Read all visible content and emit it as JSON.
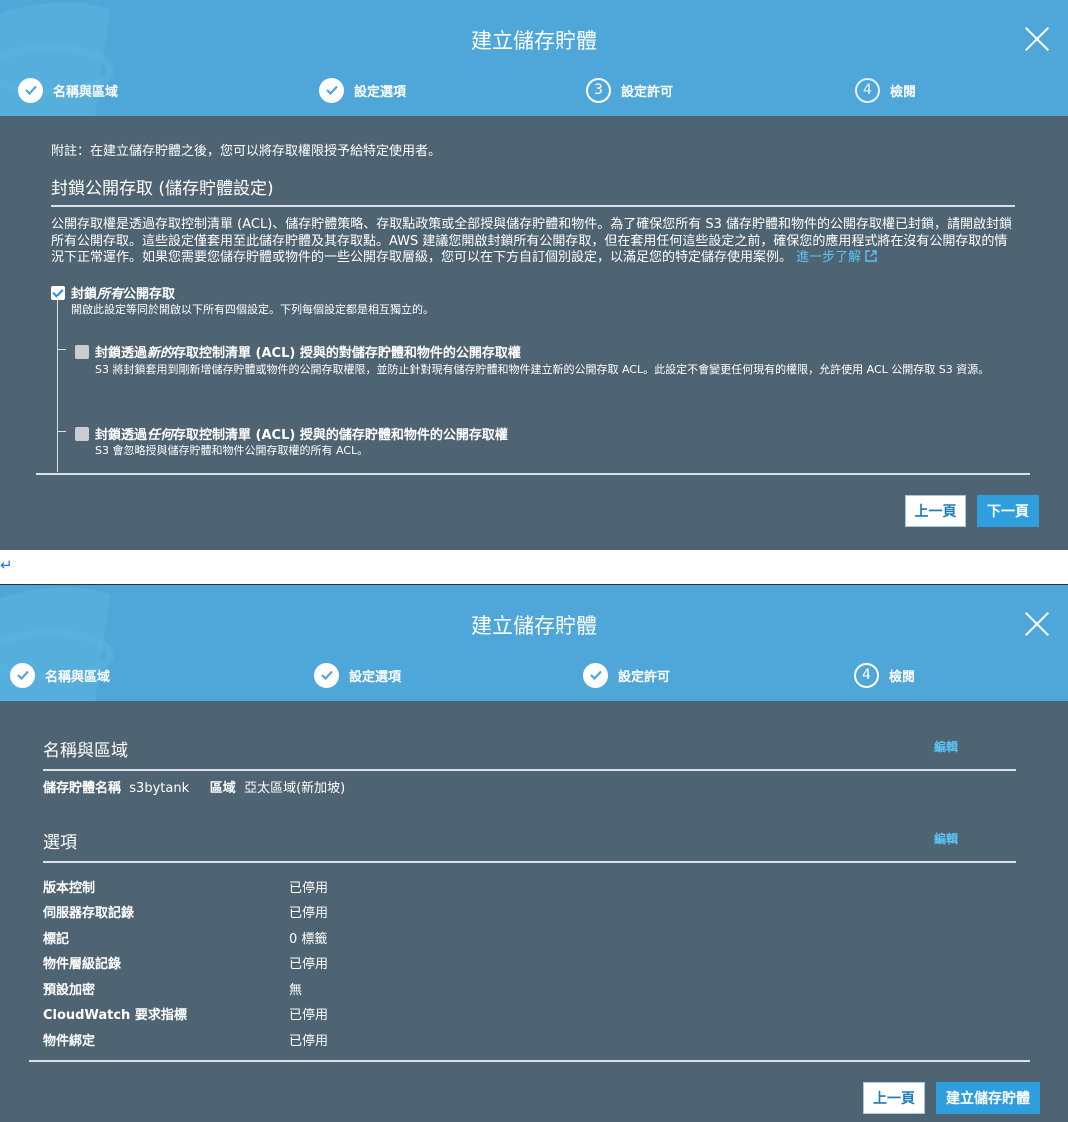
{
  "modal1": {
    "title": "建立儲存貯體",
    "steps": [
      {
        "label": "名稱與區域",
        "state": "done"
      },
      {
        "label": "設定選項",
        "state": "done"
      },
      {
        "label": "設定許可",
        "state": "current",
        "num": "3"
      },
      {
        "label": "檢閱",
        "state": "pending",
        "num": "4"
      }
    ],
    "note": "附註：在建立儲存貯體之後，您可以將存取權限授予給特定使用者。",
    "section_title": "封鎖公開存取 (儲存貯體設定)",
    "description": "公開存取權是透過存取控制清單 (ACL)、儲存貯體策略、存取點政策或全部授與儲存貯體和物件。為了確保您所有 S3 儲存貯體和物件的公開存取權已封鎖，請開啟封鎖所有公開存取。這些設定僅套用至此儲存貯體及其存取點。AWS 建議您開啟封鎖所有公開存取，但在套用任何這些設定之前，確保您的應用程式將在沒有公開存取的情況下正常運作。如果您需要您儲存貯體或物件的一些公開存取層級，您可以在下方自訂個別設定，以滿足您的特定儲存使用案例。",
    "learn_more": "進一步了解",
    "block_all": {
      "prefix": "封鎖",
      "emph": "所有",
      "suffix": "公開存取",
      "checked": true,
      "desc": "開啟此設定等同於開啟以下所有四個設定。下列每個設定都是相互獨立的。"
    },
    "option1": {
      "prefix": "封鎖透過",
      "emph": "新的",
      "suffix": "存取控制清單 (ACL) 授與的對儲存貯體和物件的公開存取權",
      "desc": "S3 將封鎖套用到剛新增儲存貯體或物件的公開存取權限，並防止針對現有儲存貯體和物件建立新的公開存取 ACL。此設定不會變更任何現有的權限，允許使用 ACL 公開存取 S3 資源。",
      "checked": false
    },
    "option2": {
      "prefix": "封鎖透過",
      "emph": "任何",
      "suffix": "存取控制清單 (ACL) 授與的儲存貯體和物件的公開存取權",
      "desc": "S3 會忽略授與儲存貯體和物件公開存取權的所有 ACL。",
      "checked": false
    },
    "prev_label": "上一頁",
    "next_label": "下一頁"
  },
  "separator_glyph": "↵",
  "modal2": {
    "title": "建立儲存貯體",
    "steps": [
      {
        "label": "名稱與區域",
        "state": "done"
      },
      {
        "label": "設定選項",
        "state": "done"
      },
      {
        "label": "設定許可",
        "state": "done"
      },
      {
        "label": "檢閱",
        "state": "current",
        "num": "4"
      }
    ],
    "name_region": {
      "title": "名稱與區域",
      "edit": "編輯",
      "bucket_label": "儲存貯體名稱",
      "bucket_value": "s3bytank",
      "region_label": "區域",
      "region_value": "亞太區域(新加坡)"
    },
    "options": {
      "title": "選項",
      "edit": "編輯",
      "rows": [
        {
          "label": "版本控制",
          "value": "已停用"
        },
        {
          "label": "伺服器存取記錄",
          "value": "已停用"
        },
        {
          "label": "標記",
          "value": "0 標籤"
        },
        {
          "label": "物件層級記錄",
          "value": "已停用"
        },
        {
          "label": "預設加密",
          "value": "無"
        },
        {
          "label": "CloudWatch 要求指標",
          "value": "已停用"
        },
        {
          "label": "物件綁定",
          "value": "已停用"
        }
      ]
    },
    "prev_label": "上一頁",
    "create_label": "建立儲存貯體"
  },
  "colors": {
    "header": "#4ea7d8",
    "body": "#4f6472",
    "primary": "#2e9fdc",
    "link": "#5cc4f5"
  }
}
